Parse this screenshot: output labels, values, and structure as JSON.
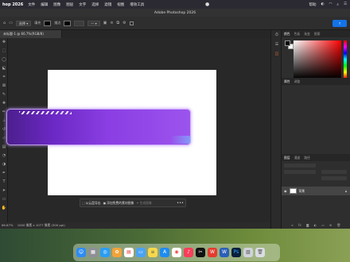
{
  "menubar": {
    "app_name": "hop 2026",
    "items": [
      "文件",
      "编辑",
      "图像",
      "图层",
      "文字",
      "选择",
      "滤镜",
      "视图",
      "增效工具"
    ],
    "right_items": [
      "帮助"
    ]
  },
  "window": {
    "title": "Adobe Photoshop 2026"
  },
  "options_bar": {
    "tool_mode": "选择",
    "fill_label": "填充",
    "stroke_label": "描边"
  },
  "document": {
    "tab_title": "未标题-1 @ 66.7%(RGB/8)"
  },
  "status_bar": {
    "zoom": "66.67%",
    "doc_info": "1000 像素 x 1077 像素 (300 ppi)"
  },
  "task_bar": {
    "buttons": [
      {
        "label": "从云盘导出",
        "dim": false
      },
      {
        "label": "添加免费的素材图像",
        "dim": false
      },
      {
        "label": "生成图像",
        "dim": true
      }
    ]
  },
  "panels": {
    "top_tabs": [
      "颜色",
      "色板",
      "渐变",
      "图案"
    ],
    "mid_tabs": [
      "属性",
      "调整"
    ],
    "layer_tabs": [
      "图层",
      "通道",
      "路径"
    ],
    "layers": [
      {
        "name": "背景",
        "visible": true,
        "locked": true
      }
    ]
  },
  "colors": {
    "foreground": "#000000",
    "background": "#ffffff",
    "accent": "#1473e6",
    "shape_gradient_start": "#4b1f8c",
    "shape_gradient_end": "#9c54ee"
  },
  "dock": {
    "icons": [
      "finder-icon",
      "launchpad-icon",
      "safari-icon",
      "photos-icon",
      "calendar-icon",
      "files-icon",
      "notes-icon",
      "appstore-icon",
      "chrome-icon",
      "music-icon",
      "capcut-icon",
      "wps-icon",
      "word-icon",
      "photoshop-icon",
      "preview-icon",
      "trash-icon"
    ],
    "photoshop_label": "Ps",
    "word_label": "W"
  }
}
